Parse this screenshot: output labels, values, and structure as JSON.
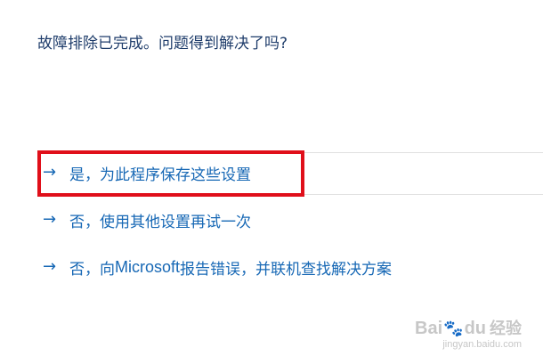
{
  "prompt": {
    "title": "故障排除已完成。问题得到解决了吗?"
  },
  "options": [
    {
      "arrow": "→",
      "label": "是，为此程序保存这些设置"
    },
    {
      "arrow": "→",
      "label": "否，使用其他设置再试一次"
    },
    {
      "arrow": "→",
      "label_before": "否，向 ",
      "brand": "Microsoft",
      "label_after": " 报告错误，并联机查找解决方案"
    }
  ],
  "annotation": {
    "highlight_color": "#e00f1a"
  },
  "watermark": {
    "logo_text_left": "Bai",
    "logo_text_right": "经验",
    "logo_paw": "du",
    "url": "jingyan.baidu.com"
  },
  "colors": {
    "title_text": "#1f3d6b",
    "link_text": "#1768b5"
  }
}
